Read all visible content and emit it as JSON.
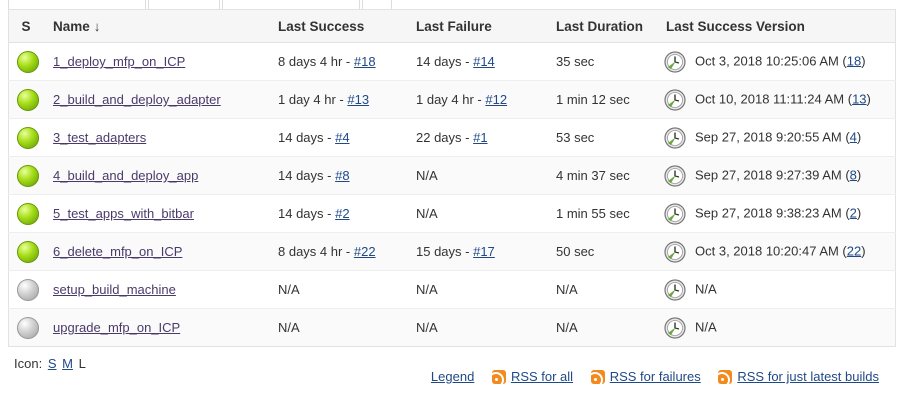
{
  "headers": {
    "s": "S",
    "name": "Name",
    "sort_arrow": "↓",
    "last_success": "Last Success",
    "last_failure": "Last Failure",
    "last_duration": "Last Duration",
    "last_success_version": "Last Success Version"
  },
  "jobs": [
    {
      "status": "blue",
      "name": "1_deploy_mfp_on_ICP",
      "ls_text": "8 days 4 hr - ",
      "ls_build": "#18",
      "lf_text": "14 days - ",
      "lf_build": "#14",
      "duration": "35 sec",
      "version_text": "Oct 3, 2018 10:25:06 AM (",
      "version_link": "18",
      "version_close": ")"
    },
    {
      "status": "blue",
      "name": "2_build_and_deploy_adapter",
      "ls_text": "1 day 4 hr - ",
      "ls_build": "#13",
      "lf_text": "1 day 4 hr - ",
      "lf_build": "#12",
      "duration": "1 min 12 sec",
      "version_text": "Oct 10, 2018 11:11:24 AM (",
      "version_link": "13",
      "version_close": ")"
    },
    {
      "status": "blue",
      "name": "3_test_adapters",
      "ls_text": "14 days - ",
      "ls_build": "#4",
      "lf_text": "22 days - ",
      "lf_build": "#1",
      "duration": "53 sec",
      "version_text": "Sep 27, 2018 9:20:55 AM (",
      "version_link": "4",
      "version_close": ")"
    },
    {
      "status": "blue",
      "name": "4_build_and_deploy_app",
      "ls_text": "14 days - ",
      "ls_build": "#8",
      "lf_text": "N/A",
      "lf_build": "",
      "duration": "4 min 37 sec",
      "version_text": "Sep 27, 2018 9:27:39 AM (",
      "version_link": "8",
      "version_close": ")"
    },
    {
      "status": "blue",
      "name": "5_test_apps_with_bitbar",
      "ls_text": "14 days - ",
      "ls_build": "#2",
      "lf_text": "N/A",
      "lf_build": "",
      "duration": "1 min 55 sec",
      "version_text": "Sep 27, 2018 9:38:23 AM (",
      "version_link": "2",
      "version_close": ")"
    },
    {
      "status": "blue",
      "name": "6_delete_mfp_on_ICP",
      "ls_text": "8 days 4 hr - ",
      "ls_build": "#22",
      "lf_text": "15 days - ",
      "lf_build": "#17",
      "duration": "50 sec",
      "version_text": "Oct 3, 2018 10:20:47 AM (",
      "version_link": "22",
      "version_close": ")"
    },
    {
      "status": "grey",
      "name": "setup_build_machine",
      "ls_text": "N/A",
      "ls_build": "",
      "lf_text": "N/A",
      "lf_build": "",
      "duration": "N/A",
      "version_text": "N/A",
      "version_link": "",
      "version_close": ""
    },
    {
      "status": "grey",
      "name": "upgrade_mfp_on_ICP",
      "ls_text": "N/A",
      "ls_build": "",
      "lf_text": "N/A",
      "lf_build": "",
      "duration": "N/A",
      "version_text": "N/A",
      "version_link": "",
      "version_close": ""
    }
  ],
  "icon_size": {
    "label": "Icon:",
    "small": "S",
    "medium": "M",
    "large": "L"
  },
  "footer": {
    "legend": "Legend",
    "rss_all": "RSS for all",
    "rss_failures": "RSS for failures",
    "rss_latest": "RSS for just latest builds"
  },
  "colors": {
    "link": "#204a87",
    "job_link": "#4a3a6a",
    "success_ball": "#a6dd18",
    "disabled_ball": "#c8c8c8",
    "rss": "#f28a1e"
  },
  "icons": {
    "success": "green-ball-icon",
    "disabled": "grey-ball-icon",
    "clock": "clock-icon",
    "rss": "rss-icon"
  }
}
